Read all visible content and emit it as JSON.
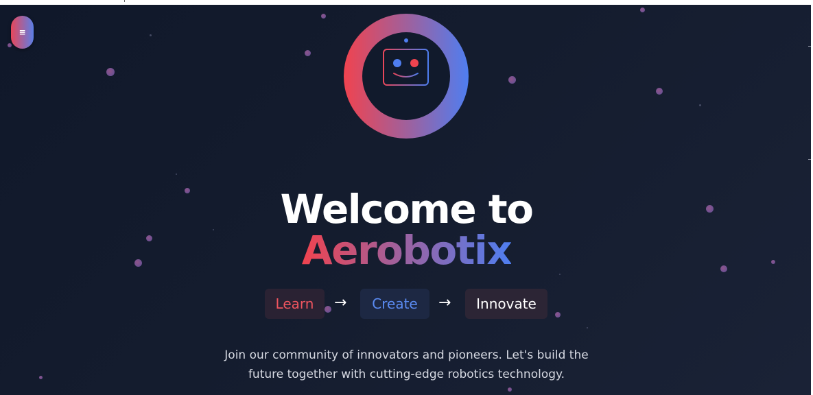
{
  "menu": {
    "icon": "menu-icon",
    "glyph": "≡"
  },
  "logo": {
    "icon": "robot-face-icon"
  },
  "hero": {
    "title_line1": "Welcome to",
    "title_line2": "Aerobotix"
  },
  "steps": {
    "learn": "Learn",
    "create": "Create",
    "innovate": "Innovate",
    "arrow": "→"
  },
  "tagline": {
    "line1": "Join our community of innovators and pioneers. Let's build the",
    "line2": "future together with cutting-edge robotics technology."
  },
  "colors": {
    "background": "#141c2e",
    "accent_red": "#f0434f",
    "accent_blue": "#4f7ef0",
    "text_primary": "#ffffff",
    "text_secondary": "#d6d9e2"
  }
}
